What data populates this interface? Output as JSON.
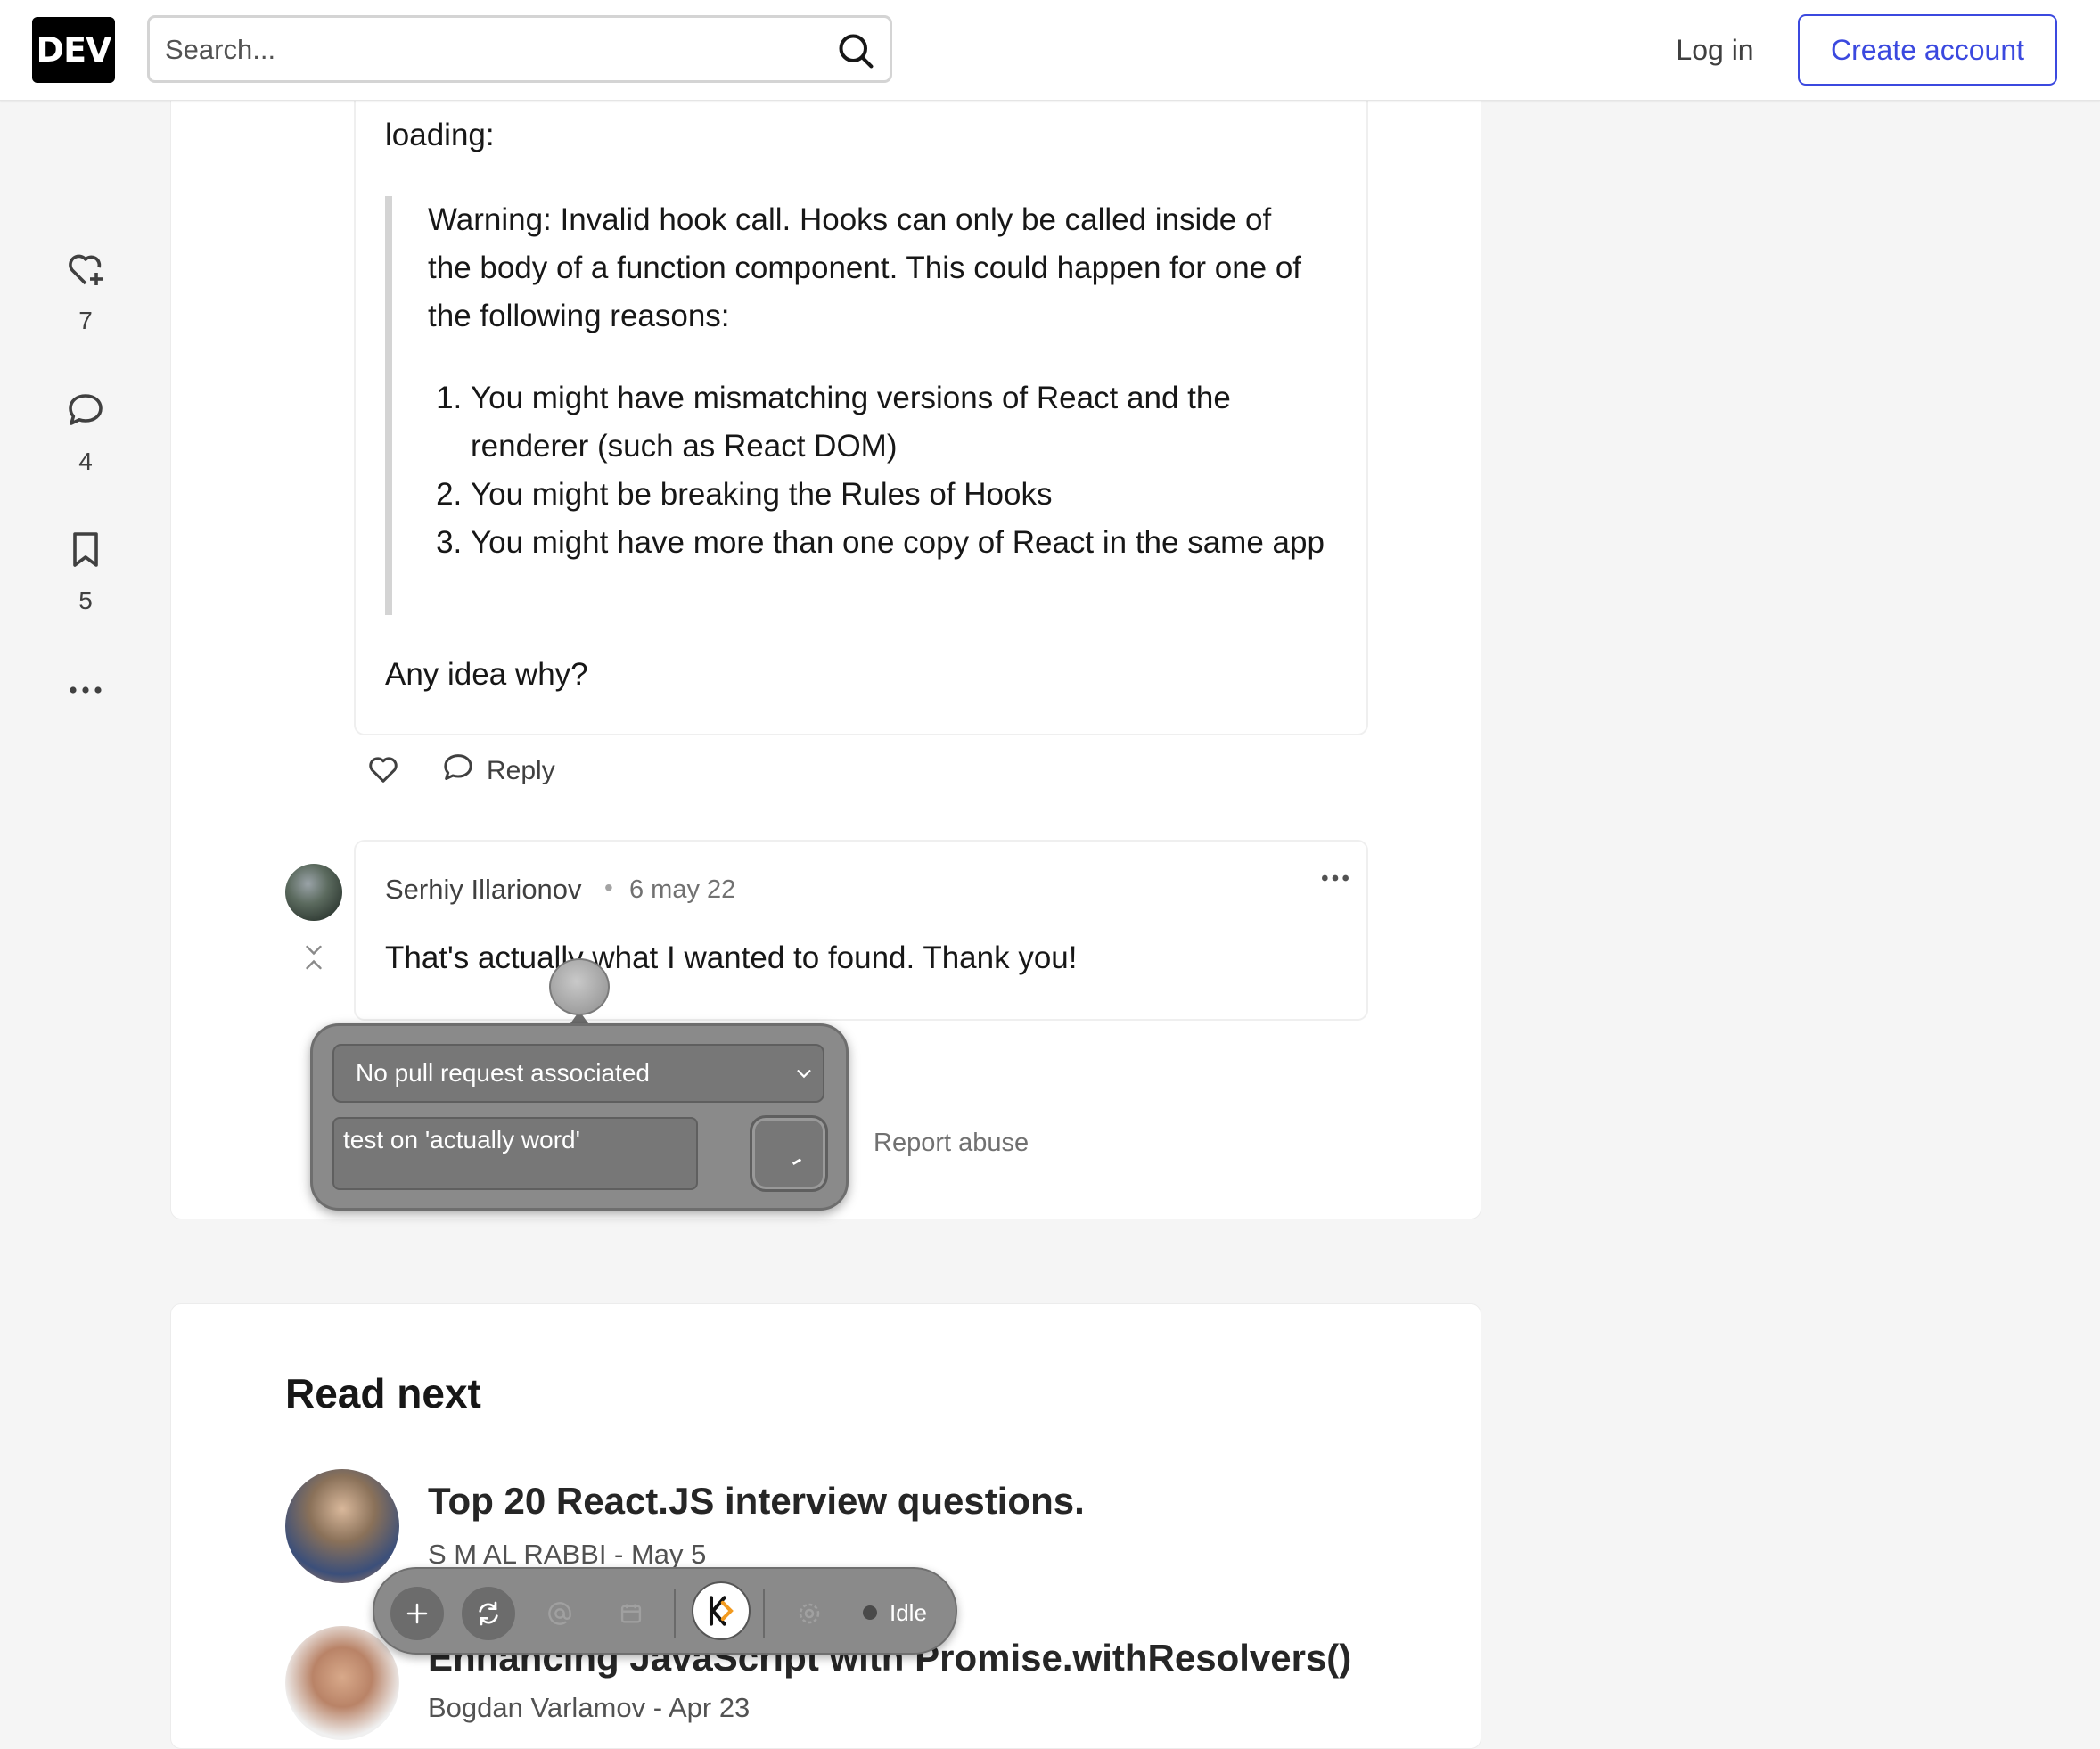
{
  "header": {
    "logo_text": "DEV",
    "search_placeholder": "Search...",
    "login_label": "Log in",
    "create_account_label": "Create account",
    "brand_color": "#3b49df"
  },
  "sidebar": {
    "reactions_count": "7",
    "comments_count": "4",
    "bookmarks_count": "5"
  },
  "comment1": {
    "intro_fragment": "loading:",
    "quote_text": "Warning: Invalid hook call. Hooks can only be called inside of the body of a function component. This could happen for one of the following reasons:",
    "reasons": [
      "You might have mismatching versions of React and the renderer (such as React DOM)",
      "You might be breaking the Rules of Hooks",
      "You might have more than one copy of React in the same app"
    ],
    "closing": "Any idea why?",
    "reply_label": "Reply"
  },
  "comment2": {
    "author": "Serhiy Illarionov",
    "separator": "•",
    "date": "6 may 22",
    "body": "That's actually what I wanted to found. Thank you!",
    "report_label": "Report abuse"
  },
  "popup": {
    "pr_select_value": "No pull request associated",
    "note_value": "test on 'actually word'"
  },
  "read_next": {
    "title": "Read next",
    "posts": [
      {
        "title": "Top 20 React.JS interview questions.",
        "meta": "S M AL RABBI - May 5"
      },
      {
        "title": "Enhancing JavaScript with Promise.withResolvers()",
        "meta": "Bogdan Varlamov - Apr 23"
      }
    ]
  },
  "toolbar": {
    "status_label": "Idle",
    "icons": [
      "plus-icon",
      "refresh-icon",
      "at-icon",
      "calendar-icon",
      "app-logo-icon",
      "settings-icon"
    ]
  }
}
